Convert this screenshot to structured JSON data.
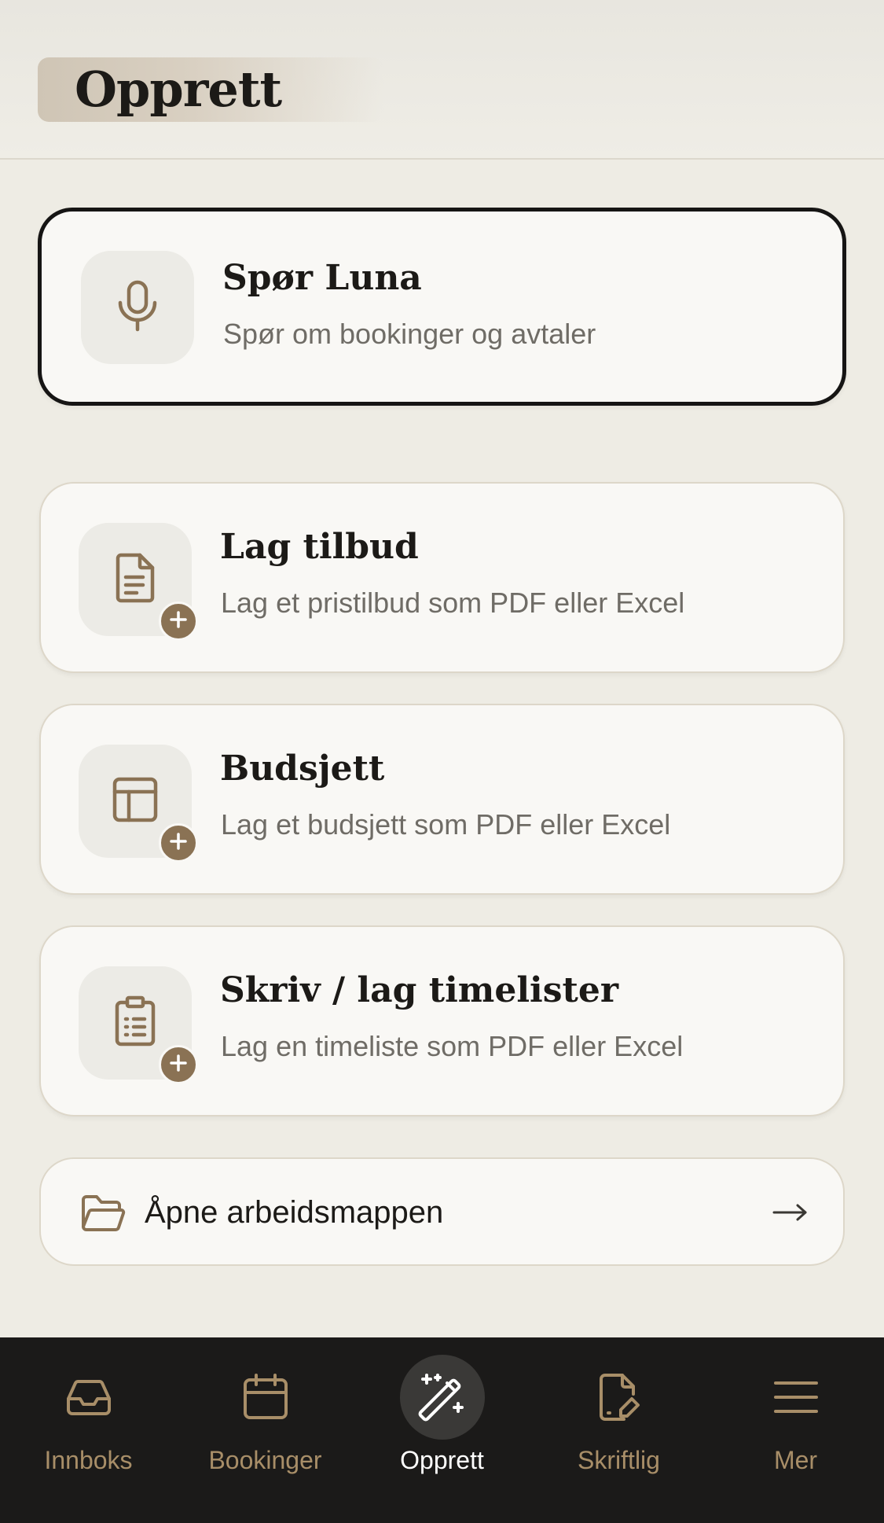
{
  "header": {
    "title": "Opprett"
  },
  "featured": {
    "title": "Spør Luna",
    "subtitle": "Spør om bookinger og avtaler",
    "icon": "microphone-icon"
  },
  "actions": [
    {
      "title": "Lag tilbud",
      "subtitle": "Lag et pristilbud som PDF eller Excel",
      "icon": "document-icon"
    },
    {
      "title": "Budsjett",
      "subtitle": "Lag et budsjett som PDF eller Excel",
      "icon": "table-icon"
    },
    {
      "title": "Skriv / lag timelister",
      "subtitle": "Lag en timeliste som PDF eller Excel",
      "icon": "clipboard-list-icon"
    }
  ],
  "folder": {
    "label": "Åpne arbeidsmappen",
    "icon": "folder-icon",
    "arrow_icon": "arrow-right-icon"
  },
  "nav": {
    "active": "Opprett",
    "items": [
      {
        "label": "Innboks",
        "icon": "inbox-icon"
      },
      {
        "label": "Bookinger",
        "icon": "calendar-icon"
      },
      {
        "label": "Opprett",
        "icon": "magic-wand-icon"
      },
      {
        "label": "Skriftlig",
        "icon": "document-pen-icon"
      },
      {
        "label": "Mer",
        "icon": "menu-icon"
      }
    ]
  },
  "colors": {
    "accent_brown": "#8a7254",
    "nav_inactive": "#a88e68",
    "nav_background": "#1b1a19",
    "page_background": "#eeece4",
    "card_background": "#f9f8f5"
  }
}
